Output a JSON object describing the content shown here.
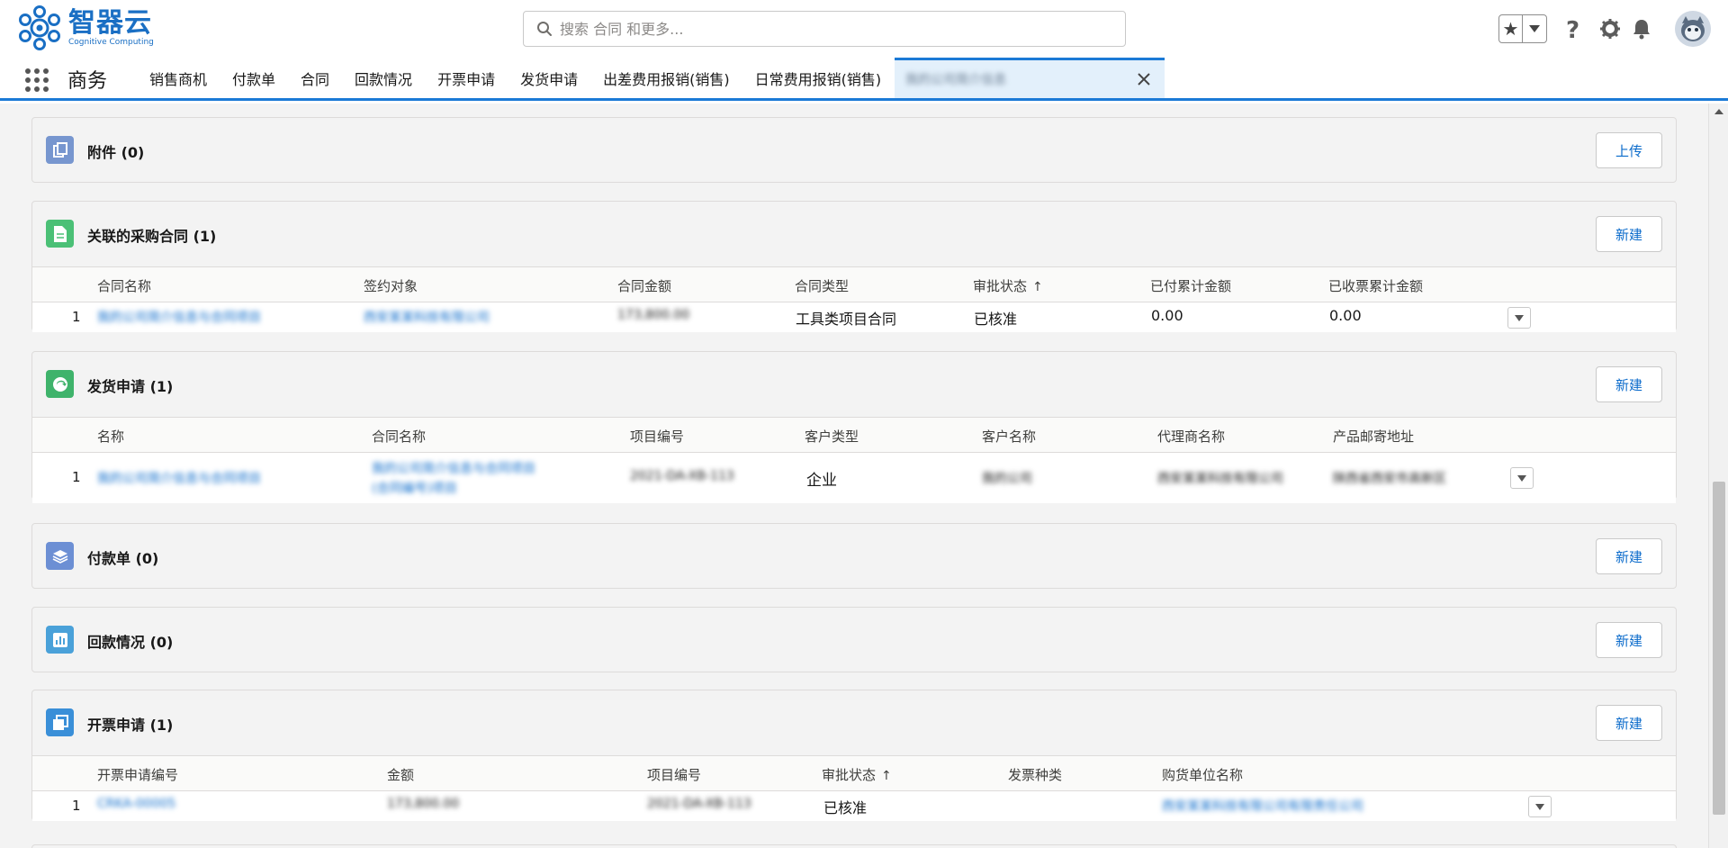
{
  "brand": {
    "name": "智器云",
    "subtitle": "Cognitive Computing",
    "color": "#1a6fc4"
  },
  "search": {
    "placeholder": "搜索 合同 和更多..."
  },
  "header_icons": [
    "star-icon",
    "chevron-down-icon",
    "help-icon",
    "gear-icon",
    "bell-icon",
    "avatar"
  ],
  "app": {
    "name": "商务"
  },
  "nav": {
    "tabs": [
      "销售商机",
      "付款单",
      "合同",
      "回款情况",
      "开票申请",
      "发货申请",
      "出差费用报销(销售)",
      "日常费用报销(销售)"
    ],
    "active_tab": "我的公司简介信息"
  },
  "sections": {
    "attachments": {
      "title": "附件 (0)",
      "button": "上传"
    },
    "purchase_contracts": {
      "title": "关联的采购合同 (1)",
      "button": "新建",
      "columns": [
        "合同名称",
        "签约对象",
        "合同金额",
        "合同类型",
        "审批状态",
        "已付累计金额",
        "已收票累计金额"
      ],
      "rows": [
        {
          "num": "1",
          "name": "我的公司简介信息与合同项目",
          "party": "西安某某科技有限公司",
          "amount": "173,800.00",
          "type": "工具类项目合同",
          "status": "已核准",
          "paid": "0.00",
          "invoiced": "0.00"
        }
      ]
    },
    "shipping_requests": {
      "title": "发货申请 (1)",
      "button": "新建",
      "columns": [
        "名称",
        "合同名称",
        "项目编号",
        "客户类型",
        "客户名称",
        "代理商名称",
        "产品邮寄地址"
      ],
      "rows": [
        {
          "num": "1",
          "name": "我的公司简介信息与合同项目",
          "contract_line1": "我的公司简介信息与合同项目",
          "contract_line2": "(合同编号)项目",
          "project_no": "2021-DA-XB-113",
          "customer_type": "企业",
          "customer": "我的公司",
          "agent": "西安某某科技有限公司",
          "address": "陕西省西安市高新区"
        }
      ]
    },
    "payments": {
      "title": "付款单 (0)",
      "button": "新建"
    },
    "receipts": {
      "title": "回款情况 (0)",
      "button": "新建"
    },
    "invoice_requests": {
      "title": "开票申请 (1)",
      "button": "新建",
      "columns": [
        "开票申请编号",
        "金额",
        "项目编号",
        "审批状态",
        "发票种类",
        "购货单位名称"
      ],
      "rows": [
        {
          "num": "1",
          "code": "CRKA-00005",
          "amount": "173,800.00",
          "project_no": "2021-DA-XB-113",
          "status": "已核准",
          "invoice_type": "",
          "buyer": "西安某某科技有限公司有限责任公司"
        }
      ]
    }
  }
}
